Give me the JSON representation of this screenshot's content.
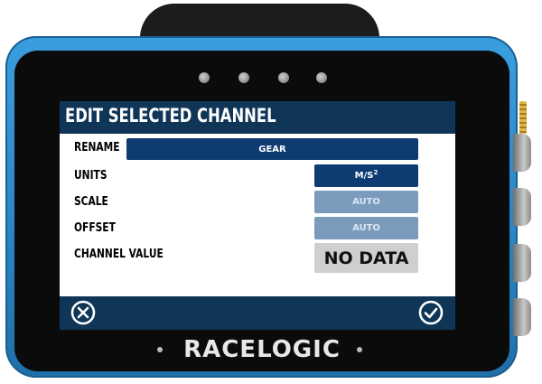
{
  "device": {
    "brand": "RACELOGIC"
  },
  "screen": {
    "title": "EDIT SELECTED CHANNEL",
    "rows": [
      {
        "label": "RENAME",
        "value": "GEAR"
      },
      {
        "label": "UNITS",
        "value": "M/S",
        "value_sup": "2"
      },
      {
        "label": "SCALE",
        "value": "AUTO"
      },
      {
        "label": "OFFSET",
        "value": "AUTO"
      },
      {
        "label": "CHANNEL VALUE",
        "value": "NO DATA"
      }
    ],
    "buttons": {
      "cancel_icon": "close-circle-icon",
      "confirm_icon": "check-circle-icon"
    }
  },
  "colors": {
    "bar": "#0f3557",
    "field_dark": "#0f3b73",
    "field_muted": "#7b9bbd",
    "field_grey": "#cfcfcf",
    "device_blue": "#2a86c7"
  }
}
